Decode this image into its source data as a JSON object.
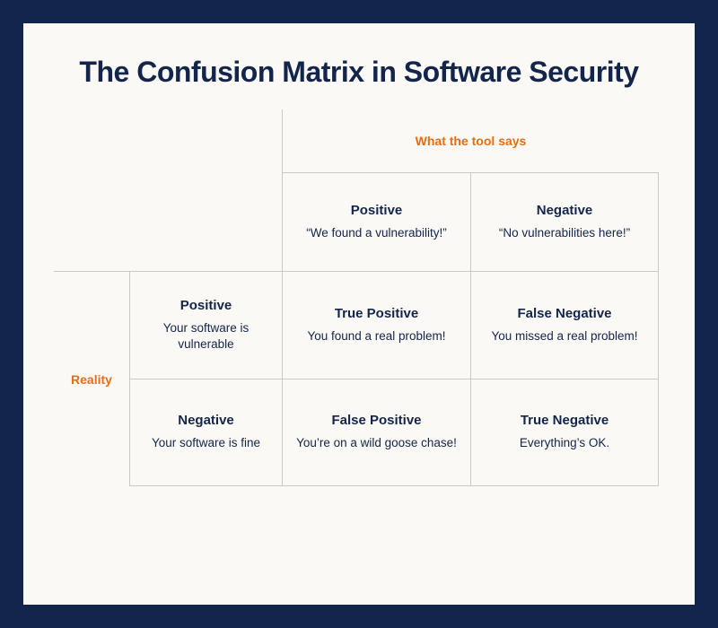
{
  "title": "The Confusion Matrix in Software Security",
  "columns_label": "What the tool says",
  "rows_label": "Reality",
  "col_headers": [
    {
      "name": "Positive",
      "desc": "“We found a vulnerability!”"
    },
    {
      "name": "Negative",
      "desc": "“No vulnerabilities here!”"
    }
  ],
  "row_headers": [
    {
      "name": "Positive",
      "desc": "Your software is vulnerable"
    },
    {
      "name": "Negative",
      "desc": "Your software is fine"
    }
  ],
  "cells": [
    [
      {
        "name": "True Positive",
        "desc": "You found a real problem!"
      },
      {
        "name": "False Negative",
        "desc": "You missed a real problem!"
      }
    ],
    [
      {
        "name": "False Positive",
        "desc": "You’re on a wild goose chase!"
      },
      {
        "name": "True Negative",
        "desc": "Everything’s OK."
      }
    ]
  ],
  "chart_data": {
    "type": "table",
    "title": "The Confusion Matrix in Software Security",
    "row_dimension": "Reality",
    "col_dimension": "What the tool says",
    "rows": [
      "Positive (vulnerable)",
      "Negative (fine)"
    ],
    "cols": [
      "Positive (found vulnerability)",
      "Negative (no vulnerability)"
    ],
    "matrix": [
      [
        "True Positive",
        "False Negative"
      ],
      [
        "False Positive",
        "True Negative"
      ]
    ]
  }
}
